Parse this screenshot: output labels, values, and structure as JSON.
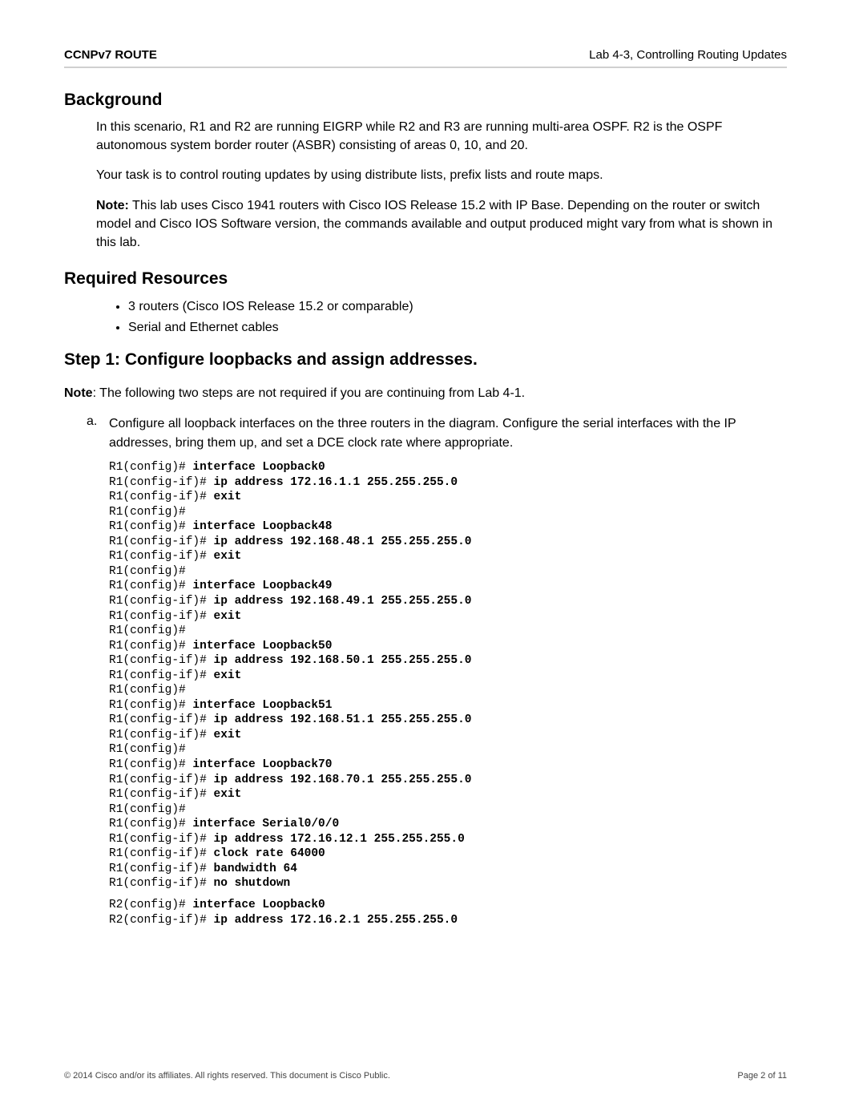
{
  "header": {
    "left": "CCNPv7 ROUTE",
    "right": "Lab 4-3, Controlling Routing Updates"
  },
  "background": {
    "heading": "Background",
    "p1": "In this scenario, R1 and R2 are running EIGRP while R2 and R3 are running multi-area OSPF. R2 is the OSPF autonomous system border router (ASBR) consisting of areas 0, 10, and 20.",
    "p2": "Your task is to control routing updates by using distribute lists, prefix lists and route maps.",
    "note_label": "Note:",
    "note_text": " This lab uses Cisco 1941 routers with Cisco IOS Release 15.2 with IP Base. Depending on the router or switch model and Cisco IOS Software version, the commands available and output produced might vary from what is shown in this lab."
  },
  "resources": {
    "heading": "Required Resources",
    "items": [
      "3 routers (Cisco IOS Release 15.2 or comparable)",
      "Serial and Ethernet cables"
    ]
  },
  "step1": {
    "heading": "Step 1: Configure loopbacks and assign addresses.",
    "note_label": "Note",
    "note_text": ": The following two steps are not required if you are continuing from Lab 4-1.",
    "sub_a_letter": "a.",
    "sub_a_text": "Configure all loopback interfaces on the three routers in the diagram. Configure the serial interfaces with the IP addresses, bring them up, and set a DCE clock rate where appropriate."
  },
  "code": {
    "r1": [
      {
        "p": "R1(config)# ",
        "c": "interface Loopback0"
      },
      {
        "p": "R1(config-if)# ",
        "c": "ip address 172.16.1.1 255.255.255.0"
      },
      {
        "p": "R1(config-if)# ",
        "c": "exit"
      },
      {
        "p": "R1(config)#",
        "c": ""
      },
      {
        "p": "R1(config)# ",
        "c": "interface Loopback48"
      },
      {
        "p": "R1(config-if)# ",
        "c": "ip address 192.168.48.1 255.255.255.0"
      },
      {
        "p": "R1(config-if)# ",
        "c": "exit"
      },
      {
        "p": "R1(config)#",
        "c": ""
      },
      {
        "p": "R1(config)# ",
        "c": "interface Loopback49"
      },
      {
        "p": "R1(config-if)# ",
        "c": "ip address 192.168.49.1 255.255.255.0"
      },
      {
        "p": "R1(config-if)# ",
        "c": "exit"
      },
      {
        "p": "R1(config)#",
        "c": ""
      },
      {
        "p": "R1(config)# ",
        "c": "interface Loopback50"
      },
      {
        "p": "R1(config-if)# ",
        "c": "ip address 192.168.50.1 255.255.255.0"
      },
      {
        "p": "R1(config-if)# ",
        "c": "exit"
      },
      {
        "p": "R1(config)#",
        "c": ""
      },
      {
        "p": "R1(config)# ",
        "c": "interface Loopback51"
      },
      {
        "p": "R1(config-if)# ",
        "c": "ip address 192.168.51.1 255.255.255.0"
      },
      {
        "p": "R1(config-if)# ",
        "c": "exit"
      },
      {
        "p": "R1(config)#",
        "c": ""
      },
      {
        "p": "R1(config)# ",
        "c": "interface Loopback70"
      },
      {
        "p": "R1(config-if)# ",
        "c": "ip address 192.168.70.1 255.255.255.0"
      },
      {
        "p": "R1(config-if)# ",
        "c": "exit"
      },
      {
        "p": "R1(config)#",
        "c": ""
      },
      {
        "p": "R1(config)# ",
        "c": "interface Serial0/0/0"
      },
      {
        "p": "R1(config-if)# ",
        "c": "ip address 172.16.12.1 255.255.255.0"
      },
      {
        "p": "R1(config-if)# ",
        "c": "clock rate 64000"
      },
      {
        "p": "R1(config-if)# ",
        "c": "bandwidth 64"
      },
      {
        "p": "R1(config-if)# ",
        "c": "no shutdown"
      }
    ],
    "r2": [
      {
        "p": "R2(config)# ",
        "c": "interface Loopback0"
      },
      {
        "p": "R2(config-if)# ",
        "c": "ip address 172.16.2.1 255.255.255.0"
      }
    ]
  },
  "footer": {
    "copyright": "© 2014 Cisco and/or its affiliates. All rights reserved. This document is Cisco Public.",
    "page": "Page 2 of 11"
  }
}
